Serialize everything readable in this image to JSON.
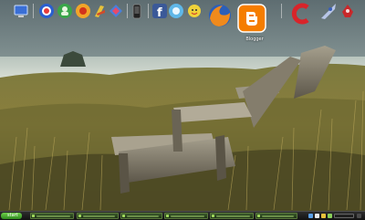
{
  "dock": {
    "items": [
      {
        "id": "my-computer-icon"
      },
      {
        "id": "windows-media-icon"
      },
      {
        "id": "contacts-icon"
      },
      {
        "id": "media-player-icon"
      },
      {
        "id": "power-tools-icon"
      },
      {
        "id": "network-icon"
      },
      {
        "id": "phone-icon"
      },
      {
        "id": "facebook-icon"
      },
      {
        "id": "twitter-icon"
      },
      {
        "id": "messenger-icon"
      },
      {
        "id": "firefox-icon"
      },
      {
        "id": "blogger-icon",
        "label": "Blogger"
      },
      {
        "id": "ccleaner-icon"
      },
      {
        "id": "rocket-icon"
      },
      {
        "id": "recycle-bin-icon"
      }
    ]
  },
  "taskbar": {
    "start_label": "start",
    "task_count": 6
  },
  "colors": {
    "taskbar_bg": "#1a1a1a",
    "start_green": "#3ea82a",
    "task_green": "#3b5a2b",
    "blogger_orange": "#f57d00",
    "facebook_blue": "#3b5998"
  }
}
